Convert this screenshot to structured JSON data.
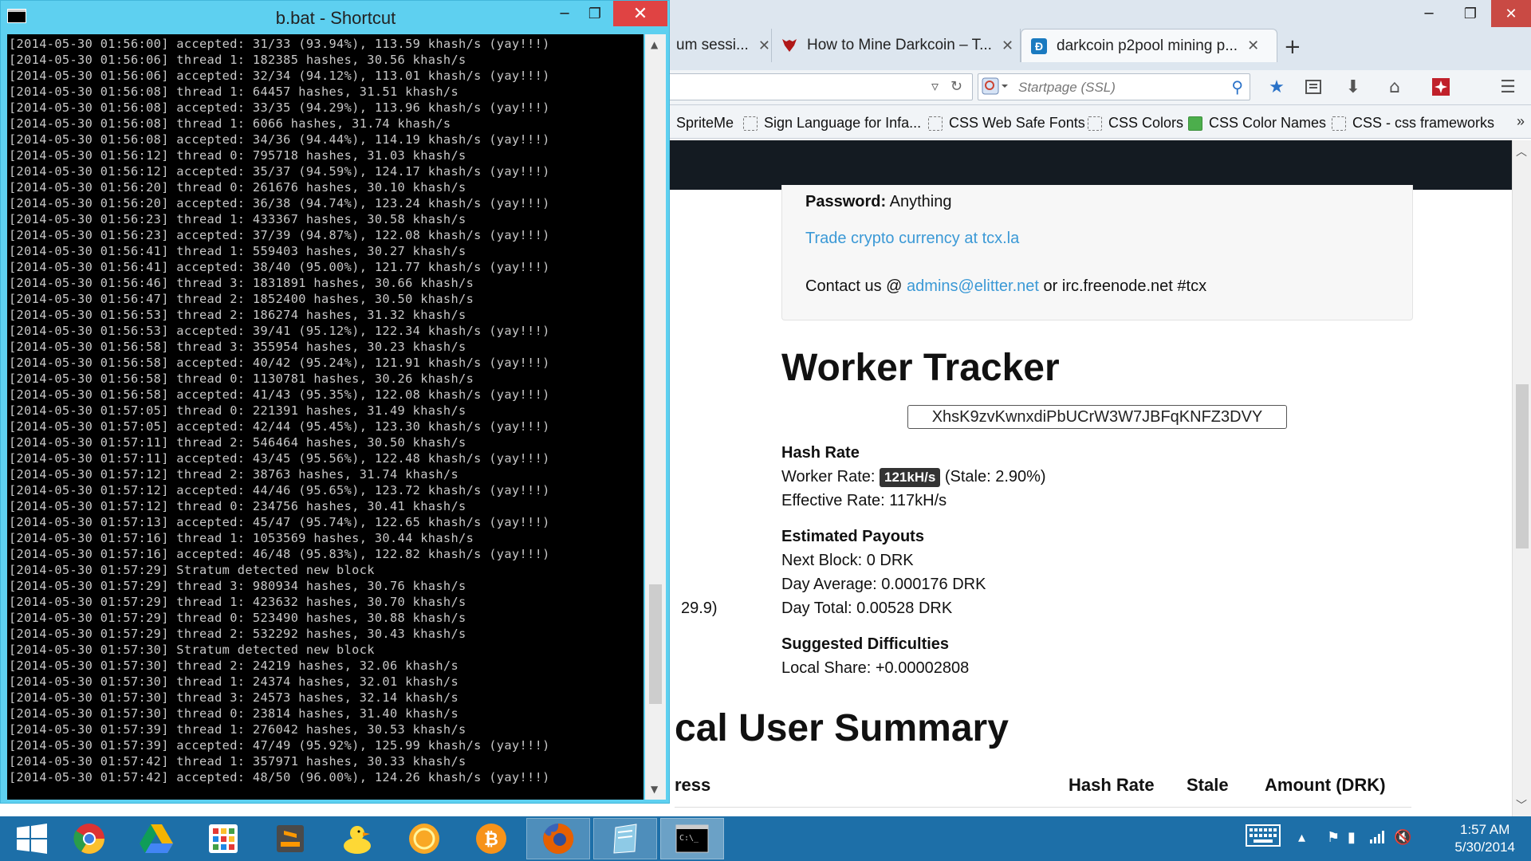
{
  "browser": {
    "tabs": [
      {
        "label": "um sessi...",
        "close": "✕"
      },
      {
        "label": "How to Mine Darkcoin – T...",
        "close": "✕"
      },
      {
        "label": "darkcoin p2pool mining p...",
        "close": "✕"
      }
    ],
    "new_tab": "+",
    "search_placeholder": "Startpage (SSL)",
    "bookmarks": [
      {
        "label": "SpriteMe"
      },
      {
        "label": "Sign Language for Infa..."
      },
      {
        "label": "CSS Web Safe Fonts"
      },
      {
        "label": "CSS Colors"
      },
      {
        "label": "CSS Color Names"
      },
      {
        "label": "CSS - css frameworks"
      }
    ],
    "bookmarks_more": "»"
  },
  "page": {
    "password_label": "Password:",
    "password_value": "Anything",
    "trade_link": "Trade crypto currency at tcx.la",
    "contact_prefix": "Contact us @",
    "contact_email": "admins@elitter.net",
    "contact_suffix": "or irc.freenode.net #tcx",
    "worker_tracker_title": "Worker Tracker",
    "worker_address": "XhsK9zvKwnxdiPbUCrW3W7JBFqKNFZ3DVY",
    "hash_rate_heading": "Hash Rate",
    "worker_rate_label": "Worker Rate:",
    "worker_rate_badge": "121kH/s",
    "stale_text": "(Stale: 2.90%)",
    "effective_rate": "Effective Rate: 117kH/s",
    "payouts_heading": "Estimated Payouts",
    "next_block": "Next Block: 0 DRK",
    "day_average": "Day Average: 0.000176 DRK",
    "day_total": "Day Total: 0.00528 DRK",
    "difficulties_heading": "Suggested Difficulties",
    "local_share": "Local Share: +0.00002808",
    "side_value": "29.9)",
    "summary_title": "cal User Summary",
    "table_headers": [
      "ress",
      "Hash Rate",
      "Stale",
      "Amount (DRK)"
    ]
  },
  "console": {
    "title": "b.bat - Shortcut",
    "lines": [
      "[2014-05-30 01:56:00] accepted: 31/33 (93.94%), 113.59 khash/s (yay!!!)",
      "[2014-05-30 01:56:06] thread 1: 182385 hashes, 30.56 khash/s",
      "[2014-05-30 01:56:06] accepted: 32/34 (94.12%), 113.01 khash/s (yay!!!)",
      "[2014-05-30 01:56:08] thread 1: 64457 hashes, 31.51 khash/s",
      "[2014-05-30 01:56:08] accepted: 33/35 (94.29%), 113.96 khash/s (yay!!!)",
      "[2014-05-30 01:56:08] thread 1: 6066 hashes, 31.74 khash/s",
      "[2014-05-30 01:56:08] accepted: 34/36 (94.44%), 114.19 khash/s (yay!!!)",
      "[2014-05-30 01:56:12] thread 0: 795718 hashes, 31.03 khash/s",
      "[2014-05-30 01:56:12] accepted: 35/37 (94.59%), 124.17 khash/s (yay!!!)",
      "[2014-05-30 01:56:20] thread 0: 261676 hashes, 30.10 khash/s",
      "[2014-05-30 01:56:20] accepted: 36/38 (94.74%), 123.24 khash/s (yay!!!)",
      "[2014-05-30 01:56:23] thread 1: 433367 hashes, 30.58 khash/s",
      "[2014-05-30 01:56:23] accepted: 37/39 (94.87%), 122.08 khash/s (yay!!!)",
      "[2014-05-30 01:56:41] thread 1: 559403 hashes, 30.27 khash/s",
      "[2014-05-30 01:56:41] accepted: 38/40 (95.00%), 121.77 khash/s (yay!!!)",
      "[2014-05-30 01:56:46] thread 3: 1831891 hashes, 30.66 khash/s",
      "[2014-05-30 01:56:47] thread 2: 1852400 hashes, 30.50 khash/s",
      "[2014-05-30 01:56:53] thread 2: 186274 hashes, 31.32 khash/s",
      "[2014-05-30 01:56:53] accepted: 39/41 (95.12%), 122.34 khash/s (yay!!!)",
      "[2014-05-30 01:56:58] thread 3: 355954 hashes, 30.23 khash/s",
      "[2014-05-30 01:56:58] accepted: 40/42 (95.24%), 121.91 khash/s (yay!!!)",
      "[2014-05-30 01:56:58] thread 0: 1130781 hashes, 30.26 khash/s",
      "[2014-05-30 01:56:58] accepted: 41/43 (95.35%), 122.08 khash/s (yay!!!)",
      "[2014-05-30 01:57:05] thread 0: 221391 hashes, 31.49 khash/s",
      "[2014-05-30 01:57:05] accepted: 42/44 (95.45%), 123.30 khash/s (yay!!!)",
      "[2014-05-30 01:57:11] thread 2: 546464 hashes, 30.50 khash/s",
      "[2014-05-30 01:57:11] accepted: 43/45 (95.56%), 122.48 khash/s (yay!!!)",
      "[2014-05-30 01:57:12] thread 2: 38763 hashes, 31.74 khash/s",
      "[2014-05-30 01:57:12] accepted: 44/46 (95.65%), 123.72 khash/s (yay!!!)",
      "[2014-05-30 01:57:12] thread 0: 234756 hashes, 30.41 khash/s",
      "[2014-05-30 01:57:13] accepted: 45/47 (95.74%), 122.65 khash/s (yay!!!)",
      "[2014-05-30 01:57:16] thread 1: 1053569 hashes, 30.44 khash/s",
      "[2014-05-30 01:57:16] accepted: 46/48 (95.83%), 122.82 khash/s (yay!!!)",
      "[2014-05-30 01:57:29] Stratum detected new block",
      "[2014-05-30 01:57:29] thread 3: 980934 hashes, 30.76 khash/s",
      "[2014-05-30 01:57:29] thread 1: 423632 hashes, 30.70 khash/s",
      "[2014-05-30 01:57:29] thread 0: 523490 hashes, 30.88 khash/s",
      "[2014-05-30 01:57:29] thread 2: 532292 hashes, 30.43 khash/s",
      "[2014-05-30 01:57:30] Stratum detected new block",
      "[2014-05-30 01:57:30] thread 2: 24219 hashes, 32.06 khash/s",
      "[2014-05-30 01:57:30] thread 1: 24374 hashes, 32.01 khash/s",
      "[2014-05-30 01:57:30] thread 3: 24573 hashes, 32.14 khash/s",
      "[2014-05-30 01:57:30] thread 0: 23814 hashes, 31.40 khash/s",
      "[2014-05-30 01:57:39] thread 1: 276042 hashes, 30.53 khash/s",
      "[2014-05-30 01:57:39] accepted: 47/49 (95.92%), 125.99 khash/s (yay!!!)",
      "[2014-05-30 01:57:42] thread 1: 357971 hashes, 30.33 khash/s",
      "[2014-05-30 01:57:42] accepted: 48/50 (96.00%), 124.26 khash/s (yay!!!)"
    ]
  },
  "taskbar": {
    "time": "1:57 AM",
    "date": "5/30/2014"
  },
  "colors": {
    "console_frame": "#5ed0f0",
    "taskbar": "#1d6fa8",
    "link": "#3b99d6",
    "site_header": "#141b22"
  }
}
